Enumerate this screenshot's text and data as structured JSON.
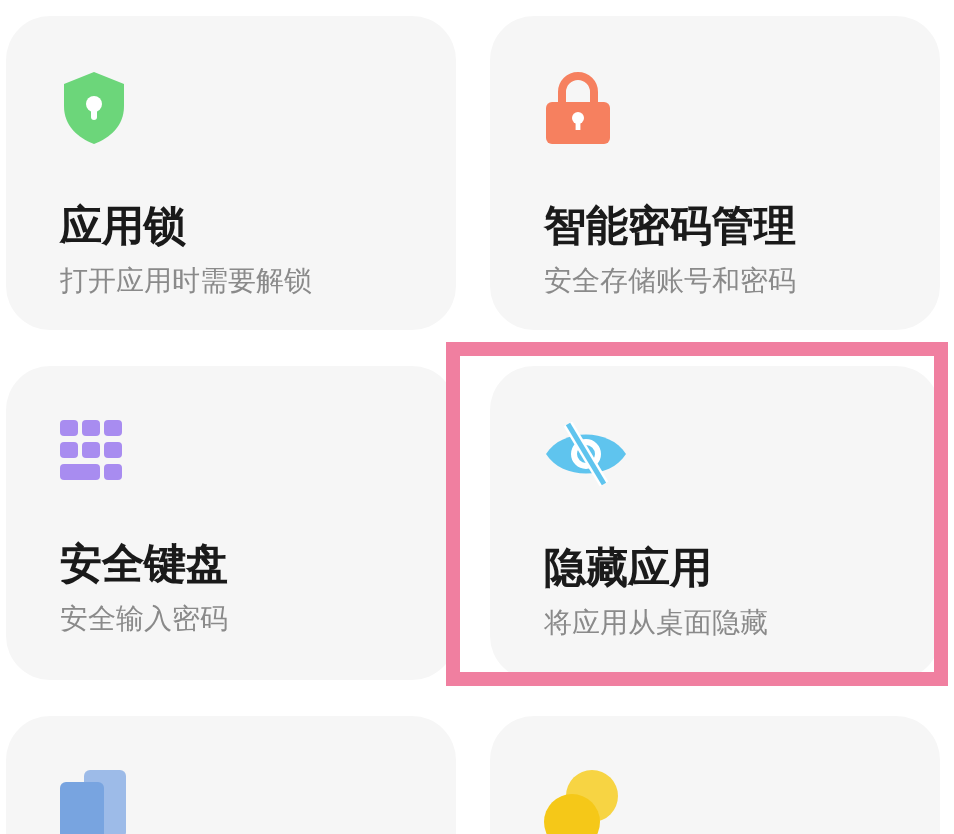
{
  "cards": [
    {
      "title": "应用锁",
      "subtitle": "打开应用时需要解锁",
      "highlighted": false
    },
    {
      "title": "智能密码管理",
      "subtitle": "安全存储账号和密码",
      "highlighted": false
    },
    {
      "title": "安全键盘",
      "subtitle": "安全输入密码",
      "highlighted": false
    },
    {
      "title": "隐藏应用",
      "subtitle": "将应用从桌面隐藏",
      "highlighted": true
    },
    {
      "highlighted": false
    },
    {
      "highlighted": false
    }
  ]
}
